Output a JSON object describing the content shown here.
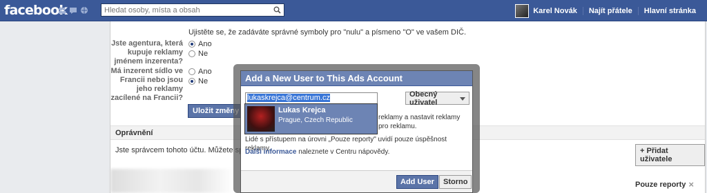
{
  "topbar": {
    "logo": "facebook",
    "search_placeholder": "Hledat osoby, místa a obsah",
    "user_name": "Karel Novák",
    "find_friends": "Najít přátele",
    "home": "Hlavní stránka",
    "brand_color": "#3b5998"
  },
  "page": {
    "top_note": "Ujistěte se, že zadáváte správné symboly pro \"nulu\" a písmeno \"O\" ve vašem DIČ.",
    "q1": {
      "label": "Jste agentura, která kupuje reklamy jménem inzerenta?",
      "yes": "Ano",
      "no": "Ne",
      "selected": "yes"
    },
    "q2": {
      "label": "Má inzerent sídlo ve Francii nebo jsou jeho reklamy zacílené na Francii?",
      "yes": "Ano",
      "no": "Ne",
      "selected": "no"
    },
    "save_button": "Uložit změny",
    "permissions_header": "Oprávnění",
    "admin_text": "Jste správcem tohoto účtu. Můžete správ",
    "add_user_button": "+ Přidat uživatele",
    "reports_label": "Pouze reporty"
  },
  "dialog": {
    "title": "Add a New User to This Ads Account",
    "email_value": "lukaskrejca@centrum.cz",
    "role_button": "Obecný uživatel",
    "text1a": "reklamy a nastavit reklamy",
    "text1b": "pro reklamu.",
    "text2": "Lidé s přístupem na úrovni „Pouze reporty\" uvidí pouze úspěšnost reklamy.",
    "more_info_link": "Další informace",
    "more_info_rest": " naleznete v Centru nápovědy.",
    "suggestion": {
      "name": "Lukas Krejca",
      "location": "Prague, Czech Republic"
    },
    "add_user": "Add User",
    "cancel": "Storno"
  }
}
